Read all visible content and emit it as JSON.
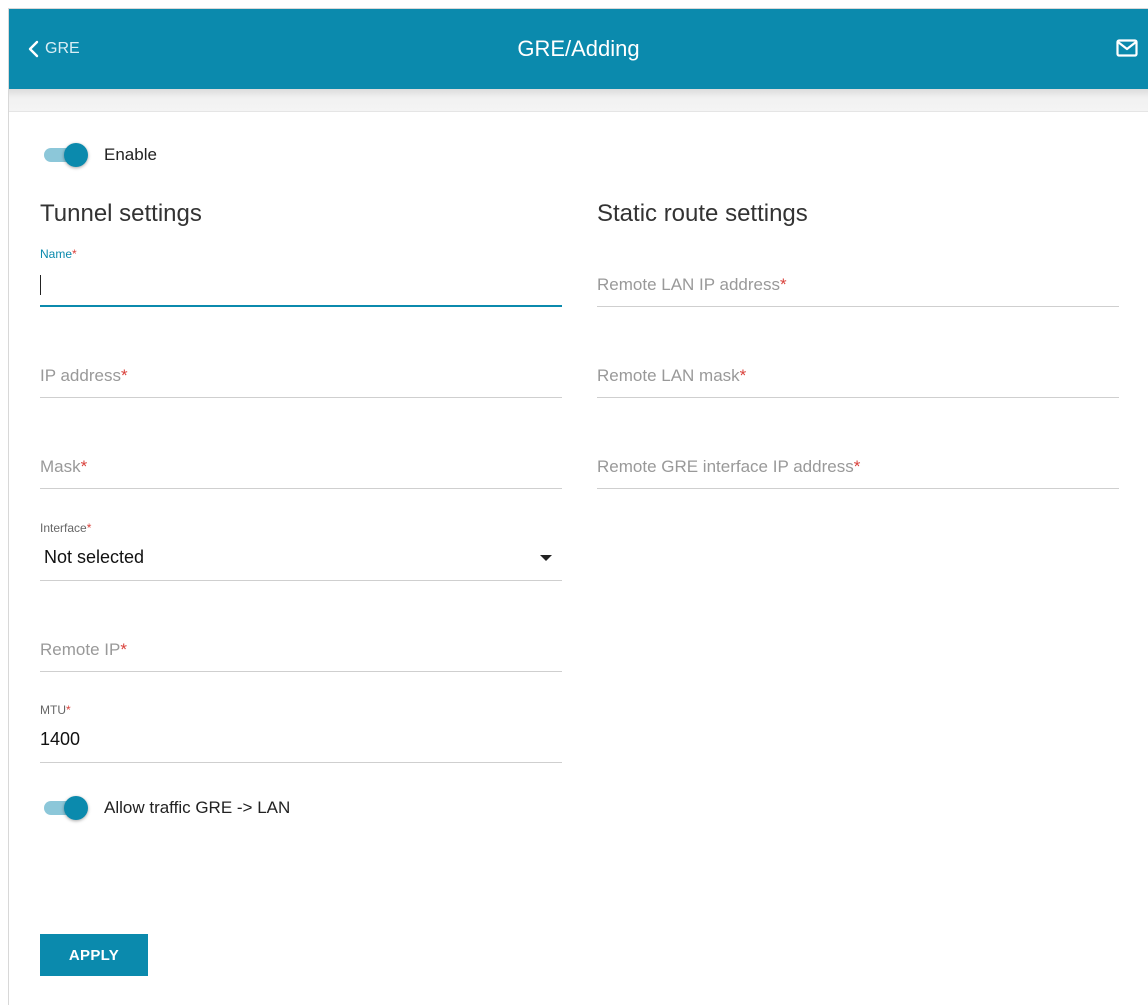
{
  "header": {
    "back_label": "GRE",
    "title": "GRE/Adding"
  },
  "enable_toggle": {
    "label": "Enable",
    "on": true
  },
  "tunnel": {
    "title": "Tunnel settings",
    "name": {
      "label": "Name",
      "value": ""
    },
    "ip_address": {
      "placeholder": "IP address"
    },
    "mask": {
      "placeholder": "Mask"
    },
    "interface": {
      "label": "Interface",
      "value": "Not selected"
    },
    "remote_ip": {
      "placeholder": "Remote IP"
    },
    "mtu": {
      "label": "MTU",
      "value": "1400"
    }
  },
  "allow_traffic_toggle": {
    "label": "Allow traffic GRE -> LAN",
    "on": true
  },
  "static_route": {
    "title": "Static route settings",
    "remote_lan_ip": {
      "placeholder": "Remote LAN IP address"
    },
    "remote_lan_mask": {
      "placeholder": "Remote LAN mask"
    },
    "remote_gre_ip": {
      "placeholder": "Remote GRE interface IP address"
    }
  },
  "required_mark": "*",
  "apply_label": "APPLY",
  "colors": {
    "accent": "#0b8aad",
    "required": "#d9413b"
  }
}
